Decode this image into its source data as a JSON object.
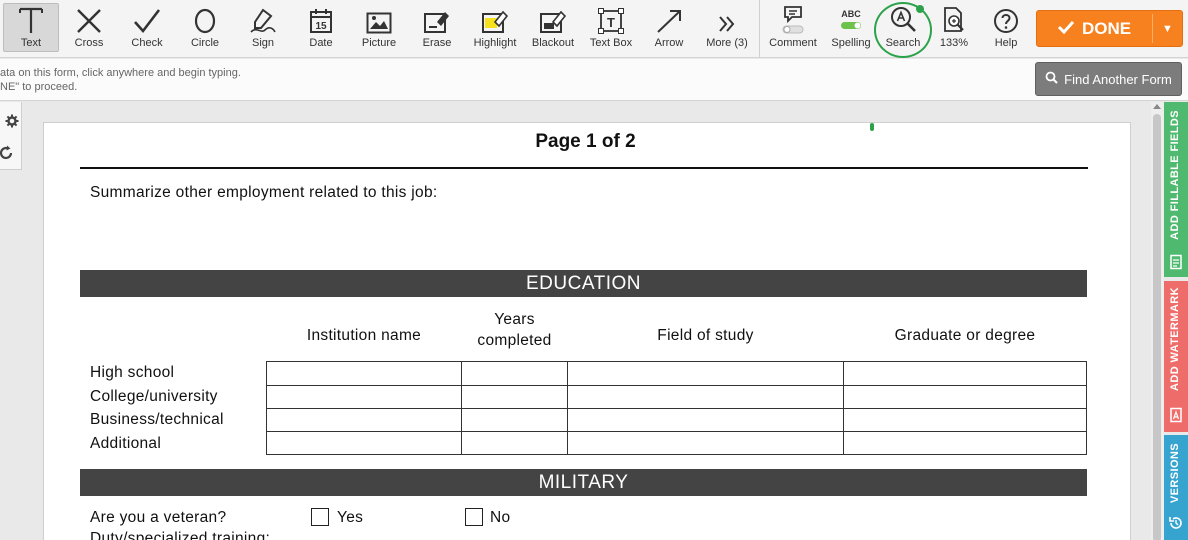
{
  "toolbar": {
    "tools": [
      {
        "id": "text",
        "label": "Text"
      },
      {
        "id": "cross",
        "label": "Cross"
      },
      {
        "id": "check",
        "label": "Check"
      },
      {
        "id": "circle",
        "label": "Circle"
      },
      {
        "id": "sign",
        "label": "Sign"
      },
      {
        "id": "date",
        "label": "Date",
        "icon_text": "15"
      },
      {
        "id": "picture",
        "label": "Picture"
      },
      {
        "id": "erase",
        "label": "Erase"
      },
      {
        "id": "highlight",
        "label": "Highlight"
      },
      {
        "id": "blackout",
        "label": "Blackout"
      },
      {
        "id": "textbox",
        "label": "Text Box",
        "icon_text": "T"
      },
      {
        "id": "arrow",
        "label": "Arrow"
      },
      {
        "id": "more",
        "label": "More (3)"
      }
    ],
    "right_tools": [
      {
        "id": "comment",
        "label": "Comment"
      },
      {
        "id": "spelling",
        "label": "Spelling",
        "icon_text": "ABC"
      },
      {
        "id": "search",
        "label": "Search"
      },
      {
        "id": "zoom",
        "label": "133%"
      },
      {
        "id": "help",
        "label": "Help"
      }
    ],
    "done_label": "DONE",
    "accent": "#f7801f"
  },
  "infobar": {
    "text": "ata on this form, click anywhere and begin typing.\nNE\" to proceed.",
    "find_label": "Find Another Form"
  },
  "side_tabs": [
    {
      "label": "ADD FILLABLE FIELDS",
      "color": "#4fb96f"
    },
    {
      "label": "ADD WATERMARK",
      "color": "#ee6d6a"
    },
    {
      "label": "VERSIONS",
      "color": "#36a4cf"
    }
  ],
  "document": {
    "page_label": "Page 1 of 2",
    "summary_prompt": "Summarize other employment related to this job:",
    "education": {
      "title": "EDUCATION",
      "columns": [
        "Institution name",
        "Years\ncompleted",
        "Field of study",
        "Graduate or degree"
      ],
      "rows": [
        "High school",
        "College/university",
        "Business/technical",
        "Additional"
      ]
    },
    "military": {
      "title": "MILITARY",
      "veteran_question": "Are you a veteran?",
      "yes_label": "Yes",
      "no_label": "No",
      "next_line": "Duty/specialized training:"
    }
  }
}
